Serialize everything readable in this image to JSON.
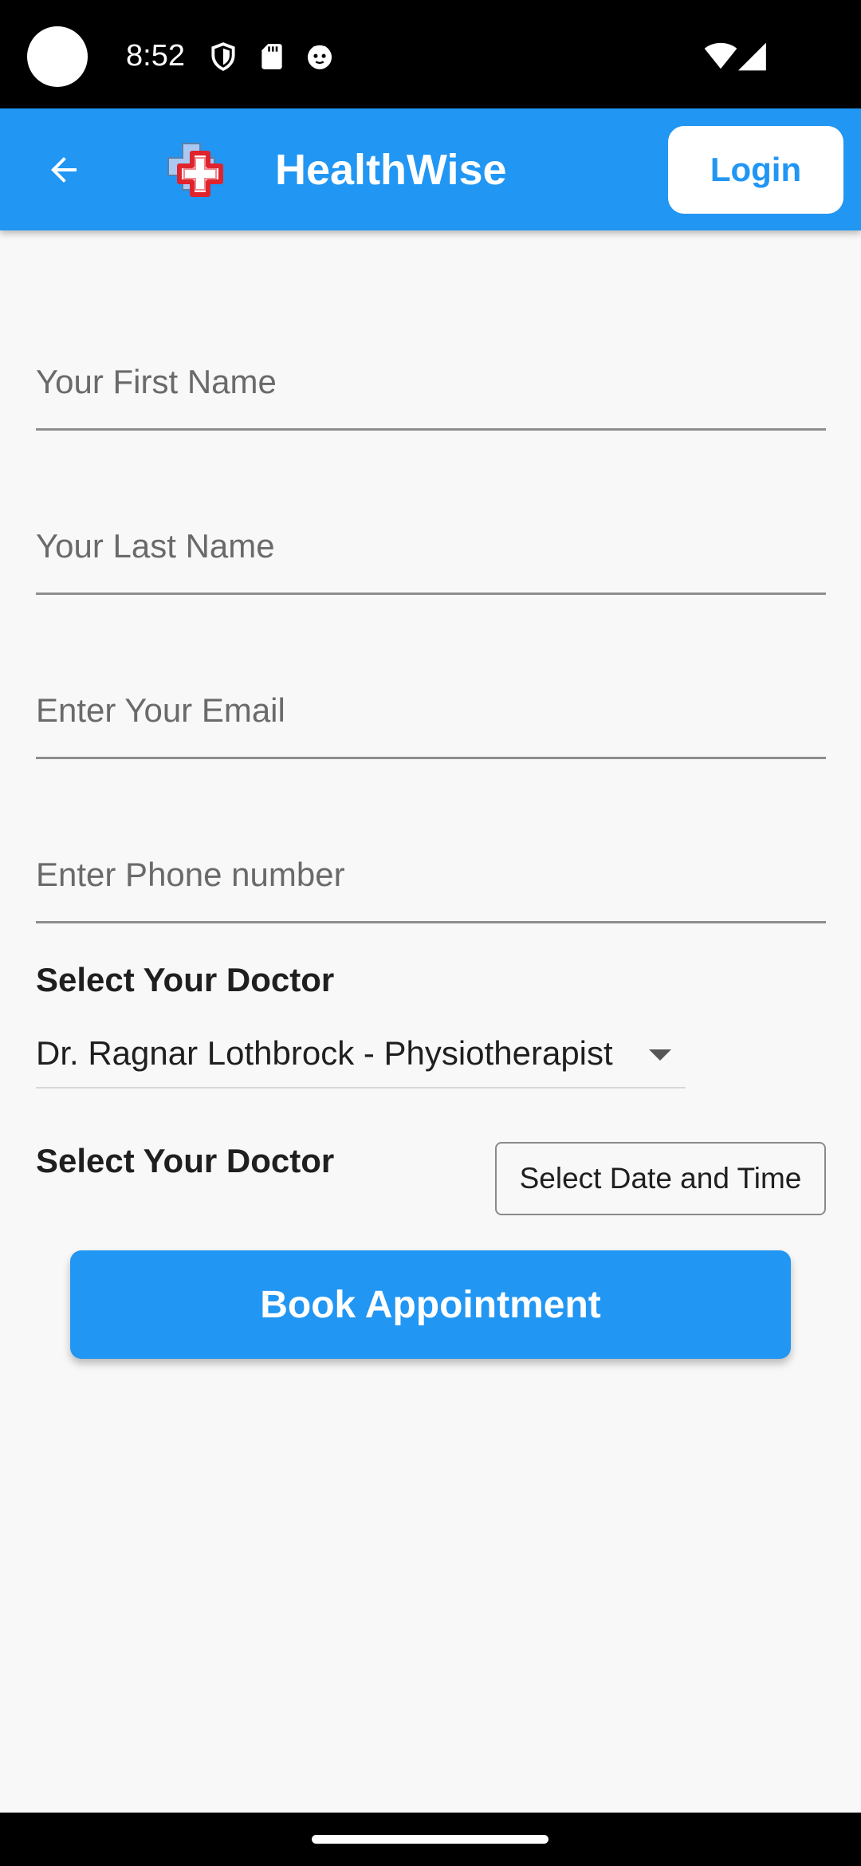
{
  "status_bar": {
    "time": "8:52",
    "left_icons": [
      "shield-icon",
      "sd-card-icon",
      "face-icon"
    ],
    "right_icons": [
      "wifi-icon",
      "signal-icon"
    ]
  },
  "app_bar": {
    "title": "HealthWise",
    "login_label": "Login",
    "logo_icon": "medical-cross-icon",
    "back_icon": "arrow-back-icon",
    "accent_color": "#2196F3"
  },
  "form": {
    "first_name_placeholder": "Your First Name",
    "last_name_placeholder": "Your Last Name",
    "email_placeholder": "Enter Your Email",
    "phone_placeholder": "Enter Phone number",
    "doctor_label": "Select Your Doctor",
    "doctor_selected": "Dr. Ragnar Lothbrock - Physiotherapist",
    "datetime_label": "Select Your Doctor",
    "datetime_button": "Select Date and Time",
    "submit_label": "Book Appointment"
  }
}
